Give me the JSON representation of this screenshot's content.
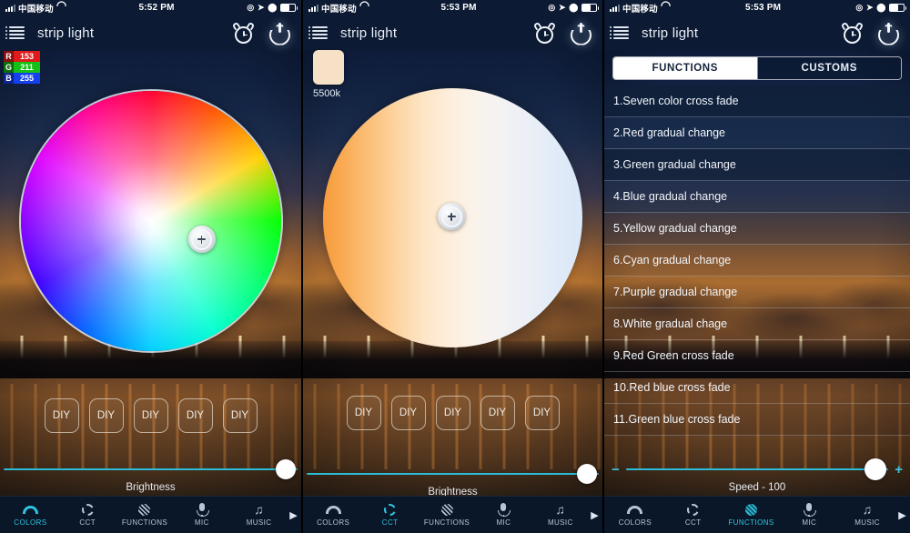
{
  "app": {
    "title": "strip light",
    "accent": "#2ec4e0",
    "header_bg": "#0c1a33"
  },
  "status_bar": {
    "carrier": "中国移动",
    "wifi_icon": "wifi-icon",
    "signal_icon": "signal-bars-icon",
    "time_p1": "5:52 PM",
    "time_p2": "5:53 PM",
    "time_p3": "5:53 PM",
    "right_icons": [
      "alarm-circle-icon",
      "location-arrow-icon",
      "rotation-lock-icon",
      "battery-icon"
    ]
  },
  "header": {
    "menu_icon": "hamburger-menu-icon",
    "alarm_icon": "alarm-clock-icon",
    "power_icon": "power-icon"
  },
  "panel_colors": {
    "rgb": {
      "r_key": "R",
      "r_value": "153",
      "g_key": "G",
      "g_value": "211",
      "b_key": "B",
      "b_value": "255",
      "r_color": "#e01b1b",
      "g_color": "#15c115",
      "b_color": "#1540f0"
    },
    "wheel_name": "color-wheel",
    "handle_name": "color-picker-handle",
    "diy_buttons": [
      "DIY",
      "DIY",
      "DIY",
      "DIY",
      "DIY"
    ],
    "brightness_label": "Brightness",
    "brightness_value": "100"
  },
  "panel_cct": {
    "swatch_color": "#f7e1c6",
    "temperature_label": "5500k",
    "wheel_name": "cct-wheel",
    "handle_name": "cct-picker-handle",
    "diy_buttons": [
      "DIY",
      "DIY",
      "DIY",
      "DIY",
      "DIY"
    ],
    "brightness_label": "Brightness",
    "brightness_value": "100"
  },
  "panel_functions": {
    "tabs": [
      {
        "label": "FUNCTIONS",
        "active": true
      },
      {
        "label": "CUSTOMS",
        "active": false
      }
    ],
    "items": [
      "1.Seven color cross fade",
      "2.Red gradual change",
      "3.Green gradual change",
      "4.Blue gradual change",
      "5.Yellow gradual change",
      "6.Cyan gradual change",
      "7.Purple gradual change",
      "8.White gradual chage",
      "9.Red Green cross fade",
      "10.Red blue cross fade",
      "11.Green blue cross fade"
    ],
    "speed_label": "Speed - 100",
    "speed_minus": "−",
    "speed_plus": "+"
  },
  "bottom_nav": {
    "items": [
      {
        "label": "COLORS",
        "icon": "colors-arc-icon"
      },
      {
        "label": "CCT",
        "icon": "cct-sun-icon"
      },
      {
        "label": "FUNCTIONS",
        "icon": "functions-striped-circle-icon"
      },
      {
        "label": "MIC",
        "icon": "microphone-icon"
      },
      {
        "label": "MUSIC",
        "icon": "music-note-icon"
      }
    ],
    "more_arrow": "▶",
    "active_p1": "COLORS",
    "active_p2": "CCT",
    "active_p3": "FUNCTIONS"
  }
}
